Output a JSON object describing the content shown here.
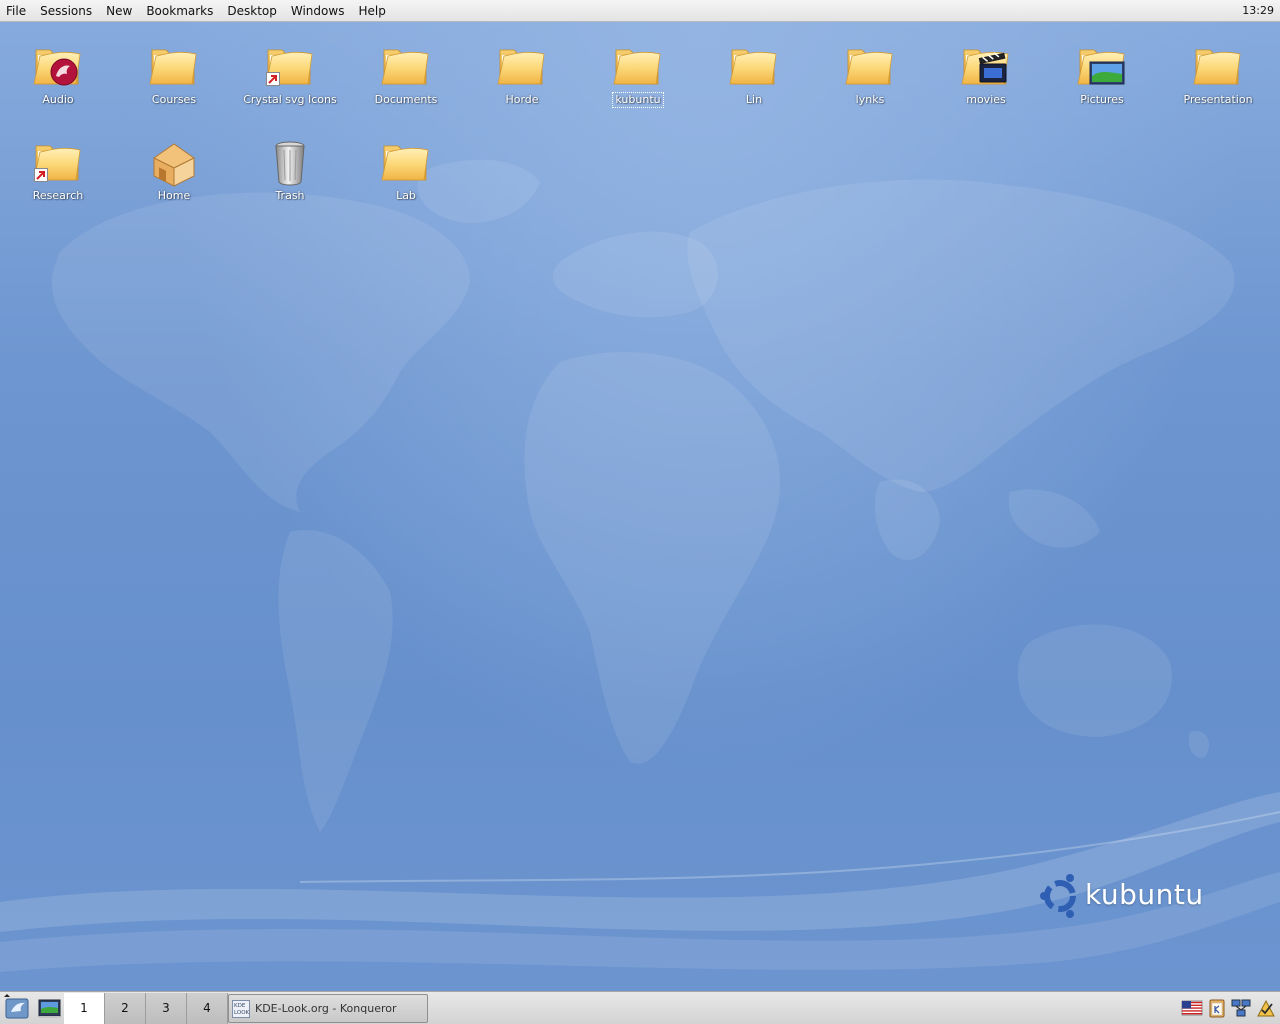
{
  "menubar": {
    "items": [
      "File",
      "Sessions",
      "New",
      "Bookmarks",
      "Desktop",
      "Windows",
      "Help"
    ],
    "clock": "13:29"
  },
  "desktop": {
    "icons": [
      {
        "label": "Audio",
        "icon": "audio-folder-icon"
      },
      {
        "label": "Courses",
        "icon": "folder-icon"
      },
      {
        "label": "Crystal svg Icons",
        "icon": "folder-link-icon"
      },
      {
        "label": "Documents",
        "icon": "folder-icon"
      },
      {
        "label": "Horde",
        "icon": "folder-icon"
      },
      {
        "label": "kubuntu",
        "icon": "folder-icon",
        "selected": true
      },
      {
        "label": "Lin",
        "icon": "folder-icon"
      },
      {
        "label": "lynks",
        "icon": "folder-icon"
      },
      {
        "label": "movies",
        "icon": "movies-folder-icon"
      },
      {
        "label": "Pictures",
        "icon": "pictures-folder-icon"
      },
      {
        "label": "Presentation",
        "icon": "folder-icon"
      },
      {
        "label": "Research",
        "icon": "folder-link-icon"
      },
      {
        "label": "Home",
        "icon": "home-icon"
      },
      {
        "label": "Trash",
        "icon": "trash-icon"
      },
      {
        "label": "Lab",
        "icon": "folder-icon"
      }
    ],
    "logo_text": "kubuntu"
  },
  "taskbar": {
    "pager": [
      "1",
      "2",
      "3",
      "4"
    ],
    "active_desktop": "1",
    "task": {
      "label": "KDE-Look.org - Konqueror",
      "icon_text": "KDE LOOK"
    },
    "tray": [
      "us-flag-icon",
      "klipper-icon",
      "network-icon",
      "updates-icon"
    ]
  },
  "colors": {
    "folder": "#f7c85a",
    "desktop_top": "#86aadd",
    "desktop_bottom": "#6690cc"
  }
}
